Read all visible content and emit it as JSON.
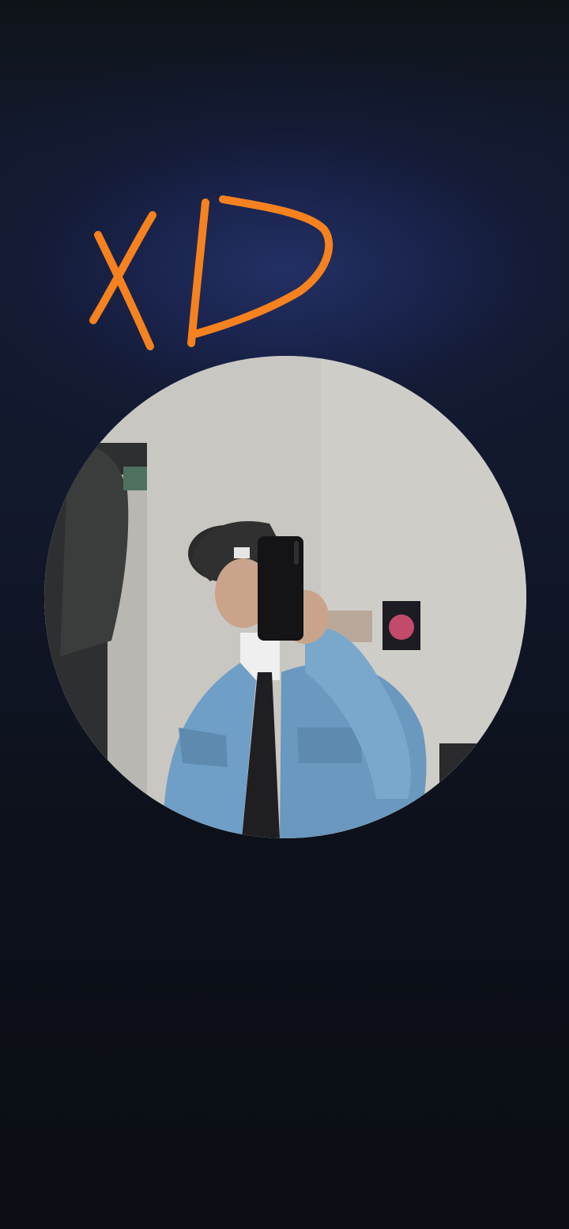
{
  "doodle": {
    "text": "XD",
    "color": "#f5821f"
  },
  "photo": {
    "icon": "profile-photo",
    "wall_color": "#c9c7c2",
    "jacket_color": "#6f9fc6"
  },
  "background": {
    "top": "#0f1318",
    "glow": "#233063",
    "bottom": "#0b0e14"
  }
}
